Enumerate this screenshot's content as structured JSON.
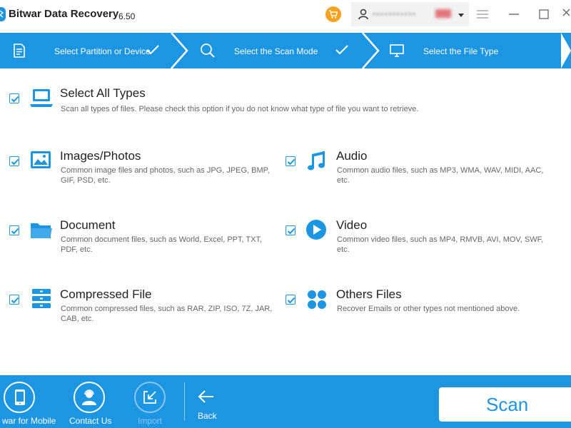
{
  "app": {
    "title": "Bitwar Data Recovery",
    "version": "6.50",
    "user_name": "•••••••••••"
  },
  "steps": [
    {
      "label": "Select Partition or Device",
      "icon": "document-icon",
      "done": true
    },
    {
      "label": "Select the Scan Mode",
      "icon": "search-icon",
      "done": true
    },
    {
      "label": "Select the File Type",
      "icon": "monitor-icon",
      "done": false
    }
  ],
  "file_types": {
    "all": {
      "title": "Select All Types",
      "desc": "Scan all types of files. Please check this option if you do not know what type of file you want to retrieve.",
      "checked": true
    },
    "images": {
      "title": "Images/Photos",
      "desc": "Common image files and photos, such as JPG, JPEG, BMP, GIF, PSD, etc.",
      "checked": true
    },
    "audio": {
      "title": "Audio",
      "desc": "Common audio files, such as MP3, WMA, WAV, MIDI, AAC, etc.",
      "checked": true
    },
    "document": {
      "title": "Document",
      "desc": "Common document files, such as World, Excel, PPT, TXT, PDF, etc.",
      "checked": true
    },
    "video": {
      "title": "Video",
      "desc": "Common video files, such as MP4, RMVB, AVI, MOV, SWF, etc.",
      "checked": true
    },
    "compressed": {
      "title": "Compressed File",
      "desc": "Common compressed files, such as RAR, ZIP, ISO, 7Z, JAR, CAB, etc.",
      "checked": true
    },
    "others": {
      "title": "Others Files",
      "desc": "Recover Emails or other types not mentioned above.",
      "checked": true
    }
  },
  "bottom": {
    "mobile_label": "war for Mobile",
    "contact_label": "Contact Us",
    "import_label": "Import",
    "back_label": "Back",
    "scan_label": "Scan"
  },
  "colors": {
    "accent": "#1c96e3",
    "cart": "#f6a21c",
    "disabled": "#8cc6ee"
  }
}
